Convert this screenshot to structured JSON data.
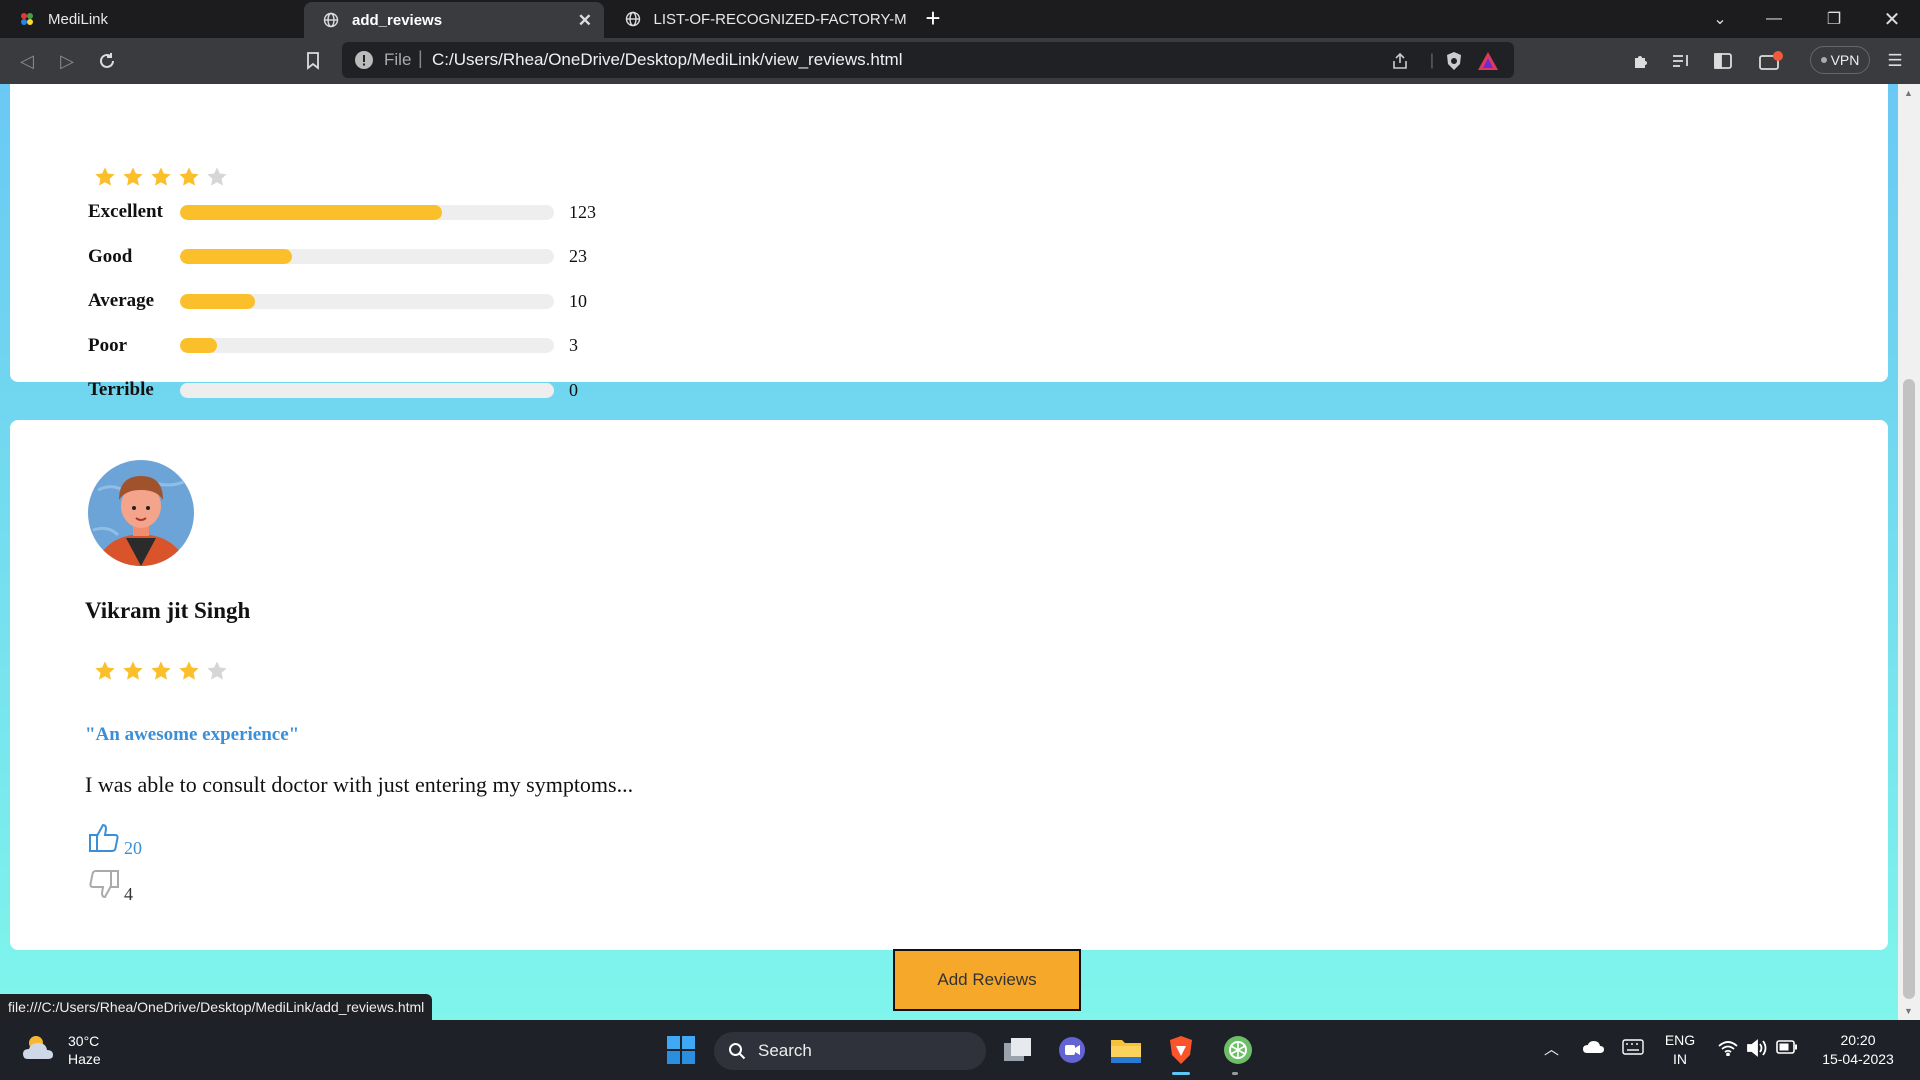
{
  "browser": {
    "tabs": [
      {
        "title": "MediLink",
        "active": false
      },
      {
        "title": "add_reviews",
        "active": true
      },
      {
        "title": "LIST-OF-RECOGNIZED-FACTORY-MED",
        "active": false
      }
    ],
    "address": {
      "scheme": "File",
      "url": "C:/Users/Rhea/OneDrive/Desktop/MediLink/view_reviews.html"
    },
    "vpn_label": "VPN",
    "status_link": "file:///C:/Users/Rhea/OneDrive/Desktop/MediLink/add_reviews.html"
  },
  "summary": {
    "stars_filled": 4,
    "stars_total": 5,
    "breakdown": [
      {
        "label": "Excellent",
        "count": "123",
        "fill": 0.7
      },
      {
        "label": "Good",
        "count": "23",
        "fill": 0.3
      },
      {
        "label": "Average",
        "count": "10",
        "fill": 0.2
      },
      {
        "label": "Poor",
        "count": "3",
        "fill": 0.1
      },
      {
        "label": "Terrible",
        "count": "0",
        "fill": 0.0
      }
    ]
  },
  "review": {
    "author": "Vikram jit Singh",
    "stars_filled": 4,
    "stars_total": 5,
    "title": "\"An awesome experience\"",
    "body": "I was able to consult doctor with just entering my symptoms...",
    "likes": "20",
    "dislikes": "4"
  },
  "actions": {
    "add_reviews_label": "Add Reviews"
  },
  "taskbar": {
    "weather_temp": "30°C",
    "weather_desc": "Haze",
    "search_placeholder": "Search",
    "lang_top": "ENG",
    "lang_bottom": "IN",
    "time": "20:20",
    "date": "15-04-2023"
  },
  "colors": {
    "star": "#fbbf2b",
    "star_empty": "#d6d6d6",
    "bar": "#fbbf2b",
    "accent_blue": "#3a8fd6",
    "button": "#f5a82a"
  }
}
